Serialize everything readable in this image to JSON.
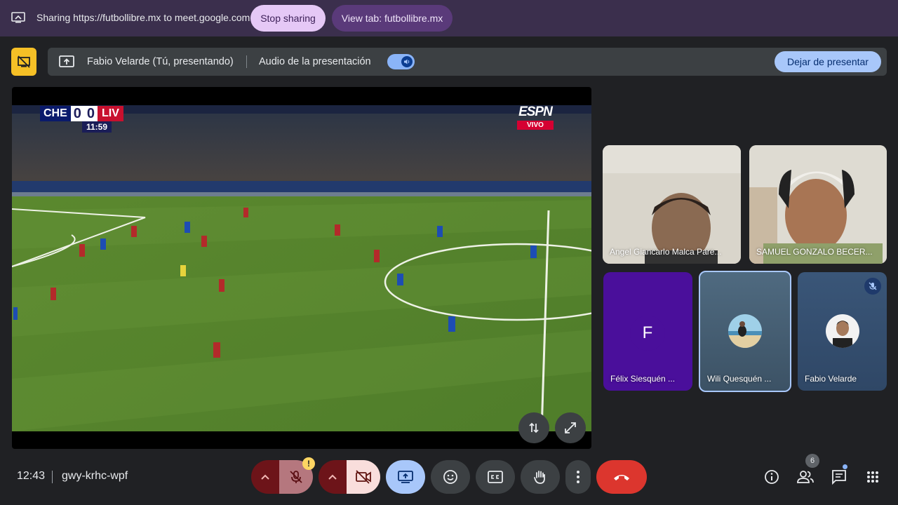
{
  "share_bar": {
    "text": "Sharing https://futbollibre.mx to meet.google.com",
    "stop_label": "Stop sharing",
    "view_label": "View tab: futbollibre.mx"
  },
  "present_bar": {
    "presenter": "Fabio Velarde (Tú, presentando)",
    "audio_label": "Audio de la presentación",
    "audio_enabled": true,
    "stop_presenting_label": "Dejar de presentar"
  },
  "shared_screen": {
    "scoreboard": {
      "home": "CHE",
      "home_score": "0",
      "away_score": "0",
      "away": "LIV",
      "clock": "11:59"
    },
    "broadcaster": "ESPN",
    "live_label": "VIVO"
  },
  "participants": [
    {
      "name": "Angel Giancarlo Malca Pare...",
      "type": "video"
    },
    {
      "name": "SAMUEL GONZALO BECER...",
      "type": "video"
    },
    {
      "name": "Félix Siesquén ...",
      "type": "avatar-letter",
      "initial": "F"
    },
    {
      "name": "Wili Quesquén ...",
      "type": "avatar-photo",
      "active_speaker": true
    },
    {
      "name": "Fabio Velarde",
      "type": "avatar-photo",
      "muted": true
    }
  ],
  "bottom_bar": {
    "time": "12:43",
    "meeting_code": "gwy-krhc-wpf",
    "people_count": "6"
  },
  "colors": {
    "share_bar": "#3b2f4d",
    "stop_sharing_btn": "#e5c8f6",
    "present_bar": "#3c4043",
    "accent_blue": "#a8c7fa",
    "leave_red": "#e94235",
    "mic_off_red": "#6d1419"
  }
}
